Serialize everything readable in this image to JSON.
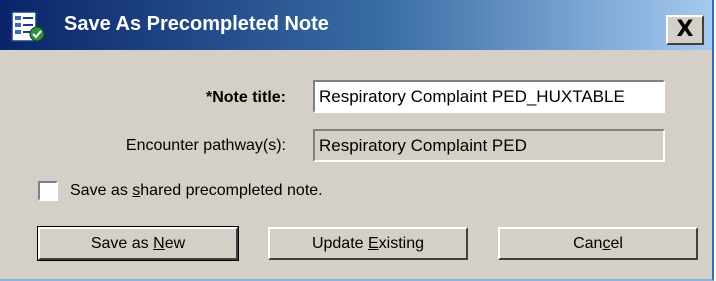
{
  "window": {
    "title": "Save As Precompleted Note",
    "close_glyph": "X",
    "icon": "note-document-icon"
  },
  "form": {
    "note_title_label": "*Note title:",
    "note_title_value": "Respiratory Complaint PED_HUXTABLE",
    "pathway_label": "Encounter pathway(s):",
    "pathway_value": "Respiratory Complaint PED",
    "shared_checkbox_label": {
      "before": "Save as ",
      "mnemonic": "s",
      "after": "hared precompleted note."
    },
    "shared_checked": false
  },
  "buttons": {
    "save_new": {
      "before": "Save as ",
      "mnemonic": "N",
      "after": "ew"
    },
    "update_existing": {
      "before": "Update ",
      "mnemonic": "E",
      "after": "xisting"
    },
    "cancel": {
      "before": "Can",
      "mnemonic": "c",
      "after": "el"
    }
  },
  "colors": {
    "titlebar_start": "#0a246a",
    "titlebar_end": "#a6caf0",
    "dialog_bg": "#d4d0c8"
  }
}
